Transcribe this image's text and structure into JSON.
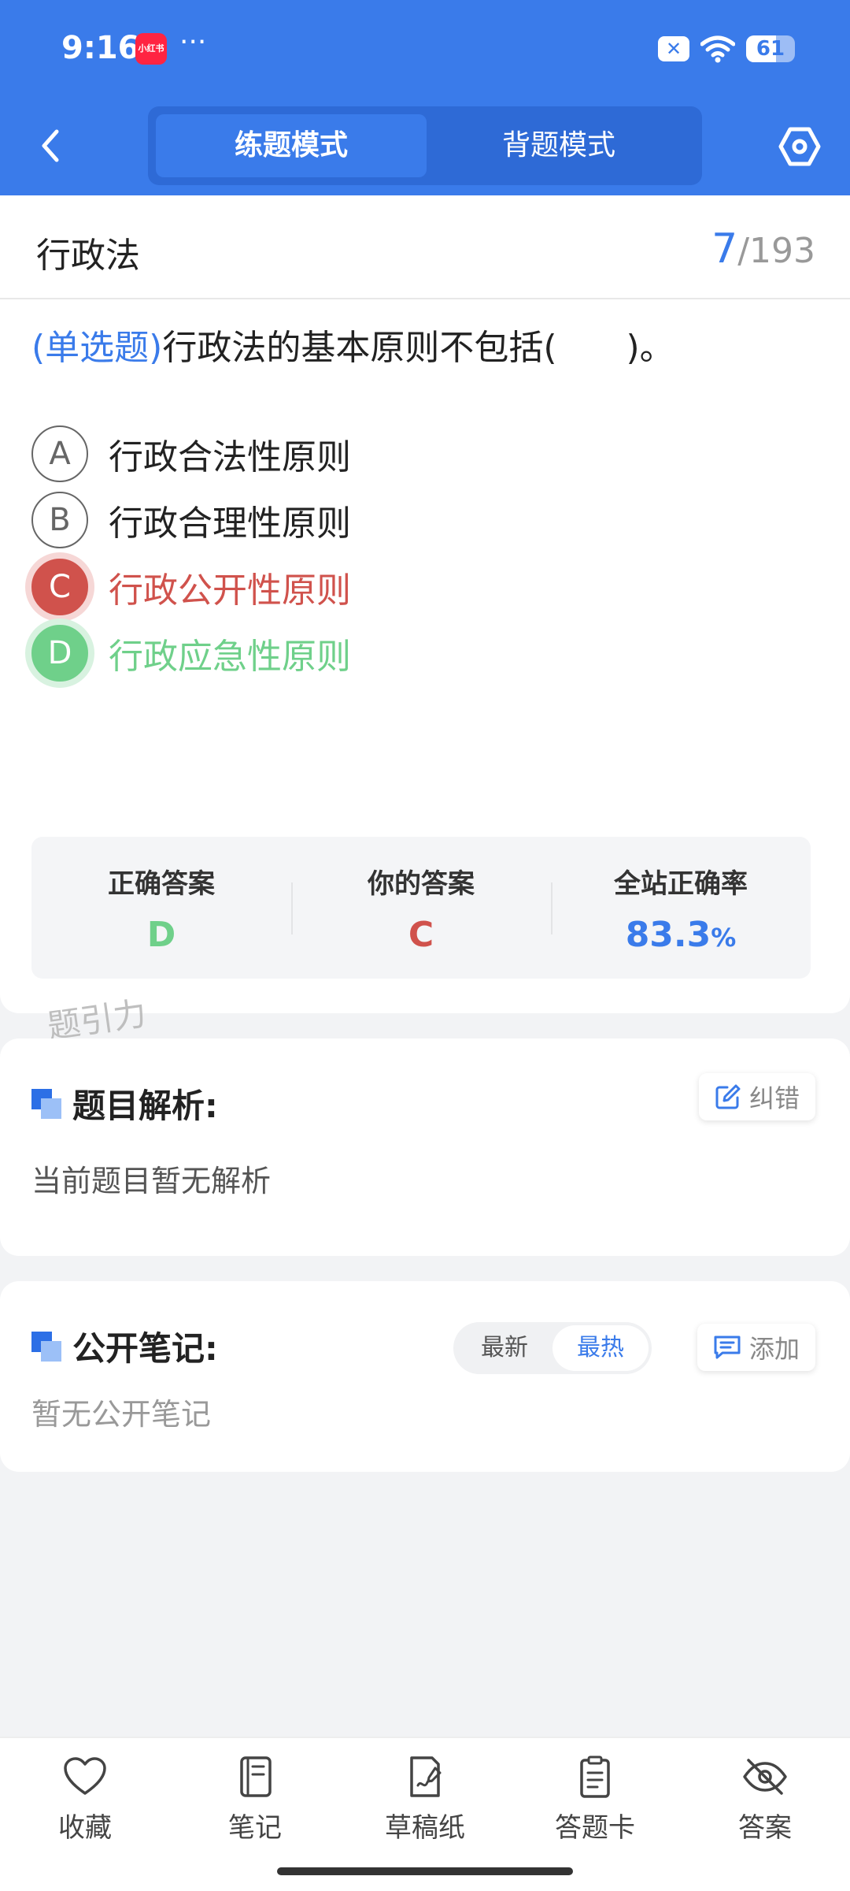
{
  "status_bar": {
    "time": "9:16",
    "app_badge": "小红书",
    "more": "···",
    "battery": "61",
    "battery_level": 0.61
  },
  "header": {
    "modes": {
      "practice": "练题模式",
      "recite": "背题模式"
    },
    "active_mode": "practice"
  },
  "subject": {
    "name": "行政法",
    "current": "7",
    "total": "/193"
  },
  "question": {
    "type": "(单选题)",
    "text": "行政法的基本原则不包括(　　)。",
    "options": [
      {
        "letter": "A",
        "text": "行政合法性原则",
        "state": "normal"
      },
      {
        "letter": "B",
        "text": "行政合理性原则",
        "state": "normal"
      },
      {
        "letter": "C",
        "text": "行政公开性原则",
        "state": "wrong"
      },
      {
        "letter": "D",
        "text": "行政应急性原则",
        "state": "right"
      }
    ]
  },
  "stats": {
    "correct_label": "正确答案",
    "correct_value": "D",
    "yours_label": "你的答案",
    "yours_value": "C",
    "rate_label": "全站正确率",
    "rate_value": "83.3",
    "rate_unit": "%"
  },
  "watermark": "题引力",
  "analysis": {
    "title": "题目解析:",
    "correct_btn": "纠错",
    "body": "当前题目暂无解析"
  },
  "notes": {
    "title": "公开笔记:",
    "sort_newest": "最新",
    "sort_hottest": "最热",
    "add_btn": "添加",
    "body": "暂无公开笔记"
  },
  "bottom_nav": [
    {
      "label": "收藏",
      "icon": "heart-icon"
    },
    {
      "label": "笔记",
      "icon": "notebook-icon"
    },
    {
      "label": "草稿纸",
      "icon": "draft-paper-icon"
    },
    {
      "label": "答题卡",
      "icon": "answer-card-icon"
    },
    {
      "label": "答案",
      "icon": "eye-off-icon"
    }
  ],
  "colors": {
    "primary": "#3a7bea",
    "wrong": "#d0524c",
    "right": "#6fd08a"
  }
}
